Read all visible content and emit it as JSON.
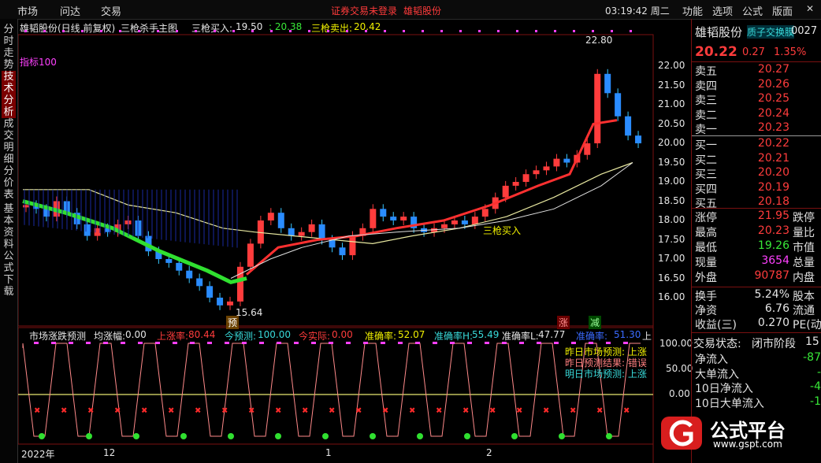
{
  "menubar": {
    "left_items": [
      "市场",
      "问达",
      "交易"
    ],
    "banner_login": "证券交易未登录",
    "banner_stock": "雄韬股份",
    "clock": "03:19:42 周二",
    "right_items": [
      "功能",
      "选项",
      "公式",
      "版面"
    ]
  },
  "left_tabs": [
    "分时走势",
    "技术分析",
    "成交明细",
    "分价表",
    "基本资料",
    "公式下载"
  ],
  "main_chart": {
    "title": "雄韬股份(日线 前复权)",
    "indicator_name": "三枪杀手主图",
    "buy_label": "三枪买入:",
    "buy_value": "19.50",
    "mid_value": ": 20.38",
    "sell_label": "三枪卖出:",
    "sell_value": "20.42",
    "indicator100": "指标100",
    "high_marker": "22.80",
    "low_marker": "15.64",
    "buy_annotation": "三枪买入",
    "yu_tag": "预",
    "zhang_tag": "涨",
    "jian_tag": "减",
    "price_axis": [
      "22.00",
      "21.50",
      "21.00",
      "20.50",
      "20.00",
      "19.50",
      "19.00",
      "18.50",
      "18.00",
      "17.50",
      "17.00",
      "16.50",
      "16.00"
    ]
  },
  "sub_chart": {
    "title": "市场涨跌预测",
    "avg_label": "均涨幅:",
    "avg_value": "0.00",
    "up_rate_label": "上涨率:",
    "up_rate_value": "80.44",
    "today_pred_label": "今预测:",
    "today_pred_value": "100.00",
    "today_actual_label": "今实际:",
    "today_actual_value": "0.00",
    "acc_label": "准确率:",
    "acc_value": "52.07",
    "acc_h_label": "准确率H:",
    "acc_h_value": "55.49",
    "acc_l_label": "准确率L:",
    "acc_l_value": "47.77",
    "extra_label": "准确率:",
    "extra_value": "51.30",
    "up_tail": "上",
    "legend_1": "昨日市场预测: 上涨",
    "legend_2": "昨日预测结果: 错误",
    "legend_3": "明日市场预测: 上涨",
    "axis": [
      "100.00",
      "50.00",
      "0.00"
    ]
  },
  "x_axis": [
    "2022年",
    "12",
    "1",
    "2"
  ],
  "right_panel": {
    "stock_name": "雄韬股份",
    "stock_code": "0027",
    "concept": "质子交换膜",
    "price": "20.22",
    "change": "0.27",
    "change_pct": "1.35%",
    "asks": [
      {
        "label": "卖五",
        "price": "20.27"
      },
      {
        "label": "卖四",
        "price": "20.26"
      },
      {
        "label": "卖三",
        "price": "20.25"
      },
      {
        "label": "卖二",
        "price": "20.24"
      },
      {
        "label": "卖一",
        "price": "20.23"
      }
    ],
    "bids": [
      {
        "label": "买一",
        "price": "20.22"
      },
      {
        "label": "买二",
        "price": "20.21"
      },
      {
        "label": "买三",
        "price": "20.20"
      },
      {
        "label": "买四",
        "price": "20.19"
      },
      {
        "label": "买五",
        "price": "20.18"
      }
    ],
    "stats": [
      {
        "label": "涨停",
        "value": "21.95",
        "right": "跌停"
      },
      {
        "label": "最高",
        "value": "20.23",
        "right": "量比"
      },
      {
        "label": "最低",
        "value": "19.26",
        "right": "市值"
      },
      {
        "label": "现量",
        "value": "3654",
        "right": "总量"
      },
      {
        "label": "外盘",
        "value": "90787",
        "right": "内盘"
      }
    ],
    "stats2": [
      {
        "label": "换手",
        "value": "5.24%",
        "right": "股本"
      },
      {
        "label": "净资",
        "value": "6.76",
        "right": "流通"
      },
      {
        "label": "收益(三)",
        "value": "0.270",
        "right": "PE(动"
      }
    ],
    "trade_state_label": "交易状态:",
    "trade_state_value": "闭市阶段",
    "trade_state_tail": "15",
    "flows": [
      {
        "label": "净流入",
        "value": "-87"
      },
      {
        "label": "大单流入",
        "value": "-"
      },
      {
        "label": "10日净流入",
        "value": "-4"
      },
      {
        "label": "10日大单流入",
        "value": "-1"
      }
    ]
  },
  "logo": {
    "text": "公式平台",
    "url": "www.gspt.com"
  },
  "colors": {
    "up": "#ff3c3c",
    "down": "#38e838",
    "accent": "#7a1010",
    "bg": "#000000"
  }
}
